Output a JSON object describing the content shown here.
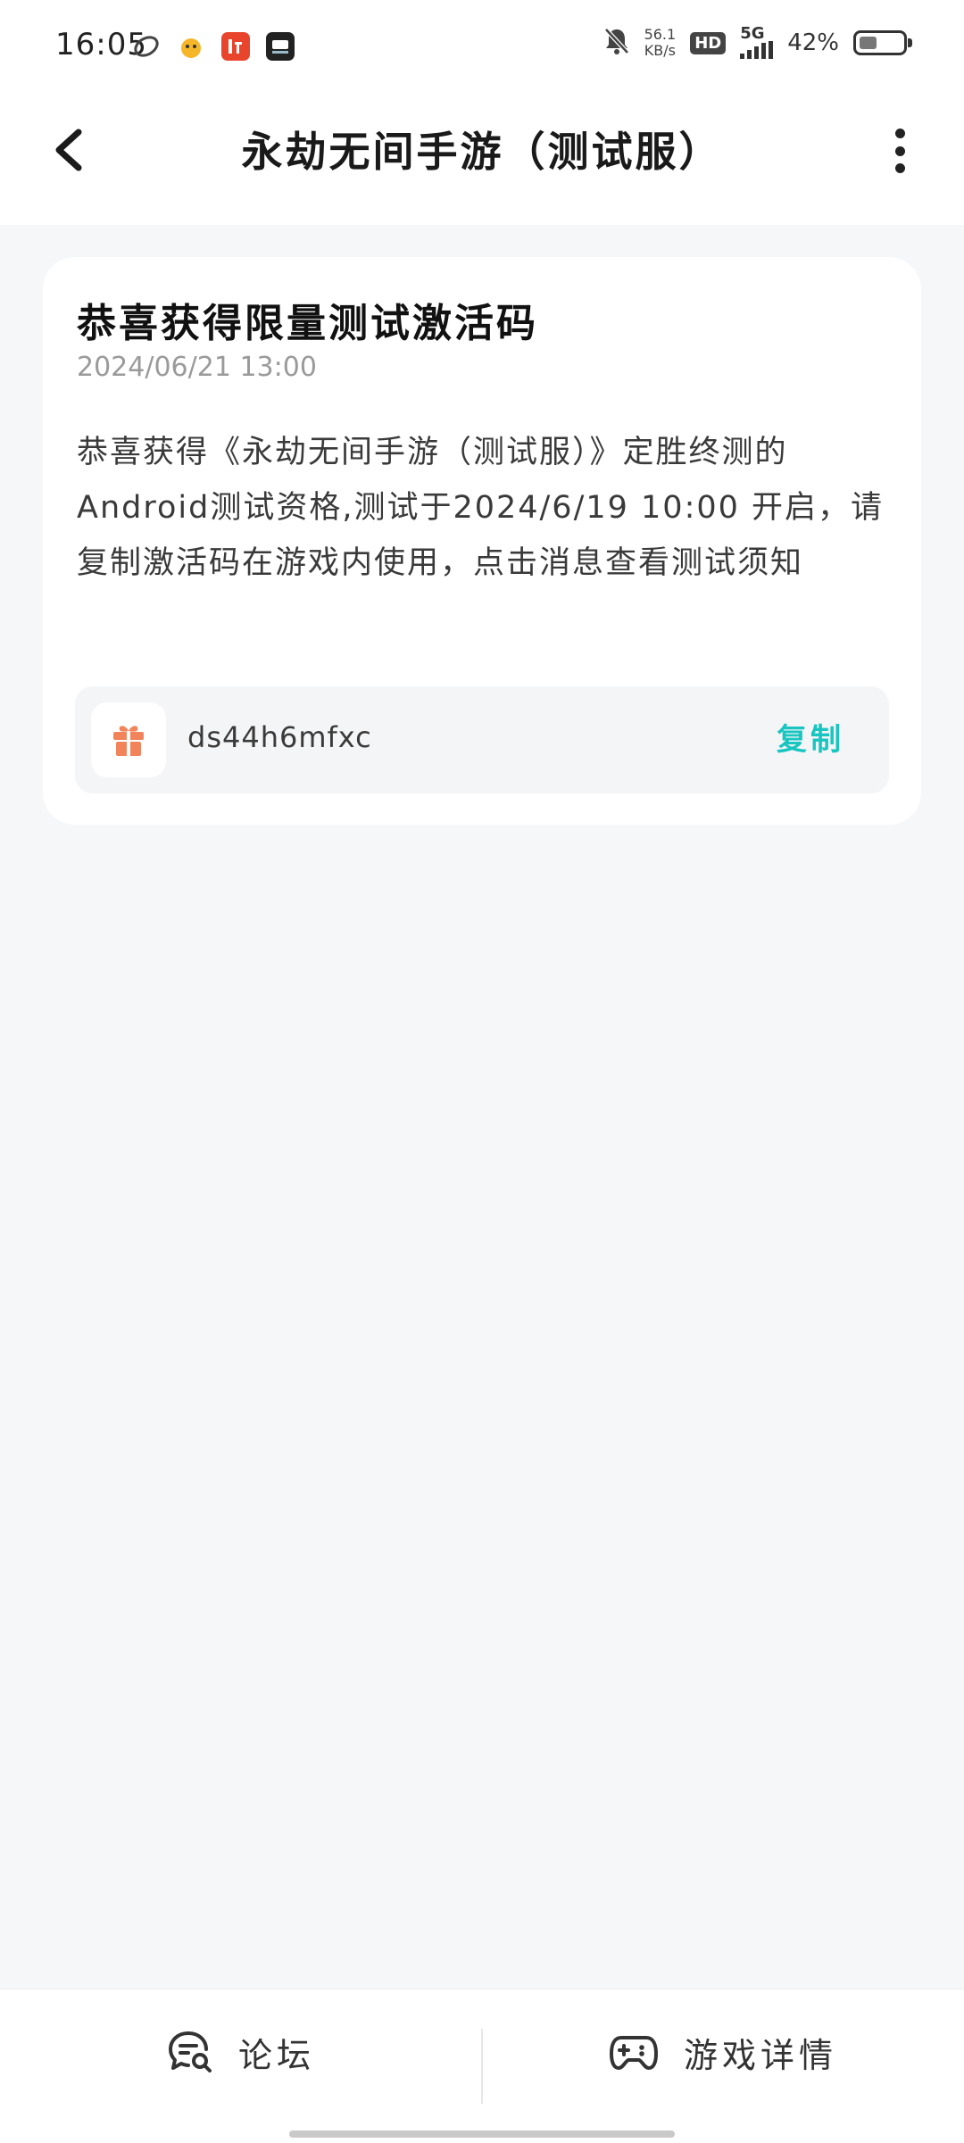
{
  "status_bar": {
    "time": "16:05",
    "net_speed_value": "56.1",
    "net_speed_unit": "KB/s",
    "hd_label": "HD",
    "network_type": "5G",
    "battery_text": "42%",
    "battery_level": 0.42,
    "apps": [
      "paper-plane-icon",
      "duck-app-icon",
      "listen-app-icon",
      "video-app-icon"
    ]
  },
  "header": {
    "title": "永劫无间手游（测试服）"
  },
  "message": {
    "title": "恭喜获得限量测试激活码",
    "date": "2024/06/21 13:00",
    "body": "恭喜获得《永劫无间手游（测试服）》定胜终测的Android测试资格,测试于2024/6/19 10:00 开启，请复制激活码在游戏内使用，点击消息查看测试须知",
    "code": "ds44h6mfxc",
    "copy_label": "复制"
  },
  "bottom_nav": {
    "forum_label": "论坛",
    "game_detail_label": "游戏详情"
  },
  "colors": {
    "accent": "#19c5c0",
    "gift": "#f2845c",
    "background": "#f6f7f9"
  }
}
